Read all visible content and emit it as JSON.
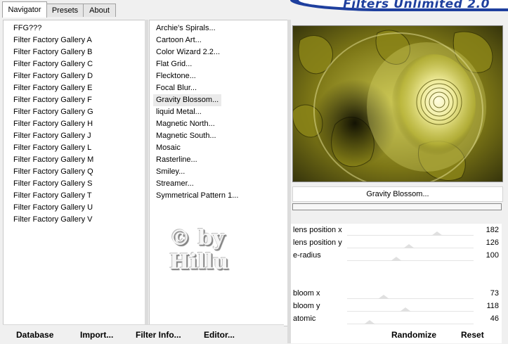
{
  "tabs": [
    "Navigator",
    "Presets",
    "About"
  ],
  "banner": "Filters Unlimited 2.0",
  "categories": [
    "FFG???",
    "Filter Factory Gallery A",
    "Filter Factory Gallery B",
    "Filter Factory Gallery C",
    "Filter Factory Gallery D",
    "Filter Factory Gallery E",
    "Filter Factory Gallery F",
    "Filter Factory Gallery G",
    "Filter Factory Gallery H",
    "Filter Factory Gallery J",
    "Filter Factory Gallery L",
    "Filter Factory Gallery M",
    "Filter Factory Gallery Q",
    "Filter Factory Gallery S",
    "Filter Factory Gallery T",
    "Filter Factory Gallery U",
    "Filter Factory Gallery V"
  ],
  "filters": [
    "Archie's Spirals...",
    "Cartoon Art...",
    "Color Wizard 2.2...",
    "Flat Grid...",
    "Flecktone...",
    "Focal Blur...",
    "Gravity Blossom...",
    "liquid Metal...",
    "Magnetic North...",
    "Magnetic South...",
    "Mosaic",
    "Rasterline...",
    "Smiley...",
    "Streamer...",
    "Symmetrical Pattern 1..."
  ],
  "selected_filter": "Gravity Blossom...",
  "watermark": [
    "© by",
    "Hillu"
  ],
  "filter_name": "Gravity Blossom...",
  "params": [
    {
      "label": "lens position x",
      "value": "182",
      "level": 0.71
    },
    {
      "label": "lens position y",
      "value": "126",
      "level": 0.49
    },
    {
      "label": "e-radius",
      "value": "100",
      "level": 0.39
    },
    {
      "label": "bloom x",
      "value": "73",
      "level": 0.29
    },
    {
      "label": "bloom y",
      "value": "118",
      "level": 0.46
    },
    {
      "label": "atomic",
      "value": "46",
      "level": 0.18
    }
  ],
  "buttons": {
    "database": "Database",
    "import": "Import...",
    "filter_info": "Filter Info...",
    "editor": "Editor...",
    "randomize": "Randomize",
    "reset": "Reset"
  },
  "colors": {
    "banner": "#1e3f9e",
    "preview_yellow": "#b8b42a",
    "preview_dark": "#2a2a08"
  }
}
